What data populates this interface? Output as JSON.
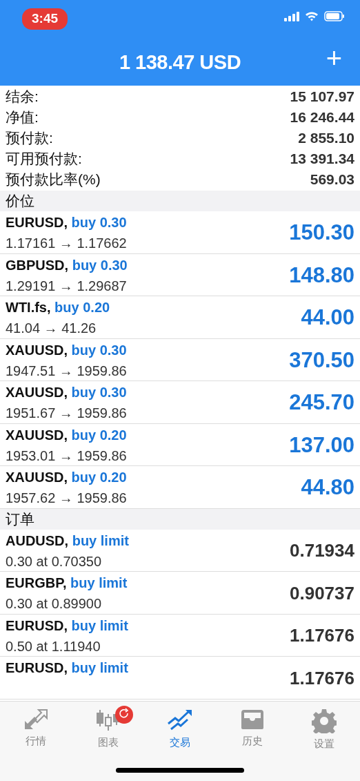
{
  "status_bar": {
    "time": "3:45"
  },
  "header": {
    "title": "1 138.47 USD",
    "add_button": "+"
  },
  "summary": [
    {
      "label": "结余:",
      "value": "15 107.97"
    },
    {
      "label": "净值:",
      "value": "16 246.44"
    },
    {
      "label": "预付款:",
      "value": "2 855.10"
    },
    {
      "label": "可用预付款:",
      "value": "13 391.34"
    },
    {
      "label": "预付款比率(%)",
      "value": "569.03"
    }
  ],
  "positions": {
    "title": "价位",
    "rows": [
      {
        "symbol": "EURUSD,",
        "action": "buy 0.30",
        "detail": "1.17161 → 1.17662",
        "value": "150.30"
      },
      {
        "symbol": "GBPUSD,",
        "action": "buy 0.30",
        "detail": "1.29191 → 1.29687",
        "value": "148.80"
      },
      {
        "symbol": "WTI.fs,",
        "action": "buy 0.20",
        "detail": "41.04 → 41.26",
        "value": "44.00"
      },
      {
        "symbol": "XAUUSD,",
        "action": "buy 0.30",
        "detail": "1947.51 → 1959.86",
        "value": "370.50"
      },
      {
        "symbol": "XAUUSD,",
        "action": "buy 0.30",
        "detail": "1951.67 → 1959.86",
        "value": "245.70"
      },
      {
        "symbol": "XAUUSD,",
        "action": "buy 0.20",
        "detail": "1953.01 → 1959.86",
        "value": "137.00"
      },
      {
        "symbol": "XAUUSD,",
        "action": "buy 0.20",
        "detail": "1957.62 → 1959.86",
        "value": "44.80"
      }
    ]
  },
  "orders": {
    "title": "订单",
    "rows": [
      {
        "symbol": "AUDUSD,",
        "action": "buy limit",
        "detail": "0.30 at 0.70350",
        "value": "0.71934"
      },
      {
        "symbol": "EURGBP,",
        "action": "buy limit",
        "detail": "0.30 at 0.89900",
        "value": "0.90737"
      },
      {
        "symbol": "EURUSD,",
        "action": "buy limit",
        "detail": "0.50 at 1.11940",
        "value": "1.17676"
      },
      {
        "symbol": "EURUSD,",
        "action": "buy limit",
        "value": "1.17676"
      }
    ]
  },
  "tab_bar": [
    {
      "kind": "quotes",
      "label": "行情",
      "selected": false
    },
    {
      "kind": "chart",
      "label": "图表",
      "selected": false,
      "badge": true
    },
    {
      "kind": "trade",
      "label": "交易",
      "selected": true
    },
    {
      "kind": "history",
      "label": "历史",
      "selected": false
    },
    {
      "kind": "settings",
      "label": "设置",
      "selected": false
    }
  ]
}
